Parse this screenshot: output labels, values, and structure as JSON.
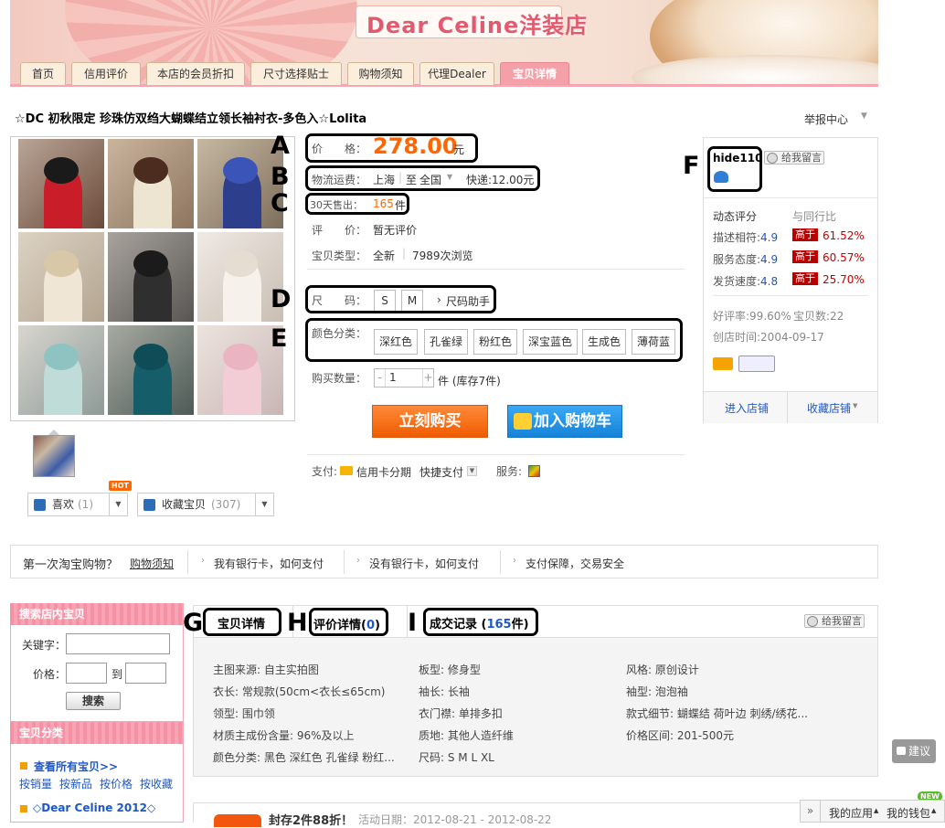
{
  "banner": {
    "brand": "Dear Celine洋装店"
  },
  "nav": {
    "tabs": [
      {
        "label": "首页"
      },
      {
        "label": "信用评价"
      },
      {
        "label": "本店的会员折扣"
      },
      {
        "label": "尺寸选择贴士"
      },
      {
        "label": "购物须知"
      },
      {
        "label": "代理Dealer"
      },
      {
        "label": "宝贝详情"
      }
    ]
  },
  "product": {
    "title": "☆DC 初秋限定 珍珠仿双绉大蝴蝶结立领长袖衬衣-多色入☆Lolita",
    "report": "举报中心",
    "price_label": "价　　格：",
    "price": "278.00",
    "price_unit": "元",
    "shipping_label": "物流运费：",
    "shipping_from": "上海",
    "shipping_sep": "至",
    "shipping_to": "全国",
    "shipping_express": "快递:12.00元",
    "sold_label": "30天售出：",
    "sold_count": "165",
    "sold_unit": "件",
    "review_label": "评　　价：",
    "review_value": "暂无评价",
    "type_label": "宝贝类型：",
    "type_value": "全新",
    "views": "7989次浏览",
    "size_label": "尺　　码：",
    "sizes": [
      "S",
      "M"
    ],
    "size_helper": "尺码助手",
    "color_label": "颜色分类：",
    "colors": [
      "深红色",
      "孔雀绿",
      "粉红色",
      "深宝蓝色",
      "生成色",
      "薄荷蓝"
    ],
    "qty_label": "购买数量：",
    "qty_value": "1",
    "qty_minus": "-",
    "qty_plus": "+",
    "stock": "件 (库存7件)",
    "buy_now": "立刻购买",
    "add_cart": "加入购物车",
    "pay_label": "支付:",
    "pay_credit": "信用卡分期",
    "pay_quick": "快捷支付",
    "service_label": "服务:",
    "like_label": "喜欢",
    "like_count": "(1)",
    "fav_label": "收藏宝贝",
    "fav_count": "(307)",
    "hot": "HOT"
  },
  "annotations": {
    "A": "A",
    "B": "B",
    "C": "C",
    "D": "D",
    "E": "E",
    "F": "F",
    "G": "G",
    "H": "H",
    "I": "I"
  },
  "seller": {
    "name": "hide110",
    "leave_msg": "给我留言",
    "dyn_label": "动态评分",
    "compare_label": "与同行比",
    "rows": [
      {
        "label": "描述相符:",
        "score": "4.9",
        "badge": "高于",
        "pct": "61.52%"
      },
      {
        "label": "服务态度:",
        "score": "4.9",
        "badge": "高于",
        "pct": "60.57%"
      },
      {
        "label": "发货速度:",
        "score": "4.8",
        "badge": "高于",
        "pct": "25.70%"
      }
    ],
    "good_rate": "好评率:99.60%",
    "item_count": "宝贝数:22",
    "created": "创店时间:2004-09-17",
    "enter_shop": "进入店铺",
    "fav_shop": "收藏店铺"
  },
  "strip": {
    "first": "第一次淘宝购物？",
    "guide": "购物须知",
    "item1": "我有银行卡，如何支付",
    "item2": "没有银行卡，如何支付",
    "item3": "支付保障，交易安全"
  },
  "sidebar": {
    "search_head": "搜索店内宝贝",
    "keyword_label": "关键字：",
    "price_label": "价格：",
    "to_label": "到",
    "search_btn": "搜索",
    "cat_head": "宝贝分类",
    "all_items": "查看所有宝贝>>",
    "sort": [
      "按销量",
      "按新品",
      "按价格",
      "按收藏"
    ],
    "category1": "◇Dear Celine 2012◇"
  },
  "detail": {
    "tab_detail": "宝贝详情",
    "tab_review": "评价详情(",
    "tab_review_count": "0",
    "tab_review_close": ")",
    "tab_deal": "成交记录 (",
    "tab_deal_count": "165",
    "tab_deal_unit": "件)",
    "leave_msg": "给我留言",
    "attrs": [
      [
        "主图来源: 自主实拍图",
        "板型: 修身型",
        "风格: 原创设计"
      ],
      [
        "衣长: 常规款(50cm<衣长≤65cm)",
        "袖长: 长袖",
        "袖型: 泡泡袖"
      ],
      [
        "领型: 围巾领",
        "衣门襟: 单排多扣",
        "款式细节: 蝴蝶结 荷叶边 刺绣/绣花..."
      ],
      [
        "材质主成份含量: 96%及以上",
        "质地: 其他人造纤维",
        "价格区间: 201-500元"
      ],
      [
        "颜色分类: 黑色 深红色 孔雀绿 粉红...",
        "尺码: S M L XL",
        ""
      ]
    ],
    "promo_title": "封存2件88折！",
    "promo_date": "活动日期：2012-08-21 - 2012-08-22"
  },
  "floating": {
    "suggest": "建议",
    "my_app": "我的应用",
    "my_wallet": "我的钱包",
    "new": "NEW",
    "collapse": "»"
  }
}
